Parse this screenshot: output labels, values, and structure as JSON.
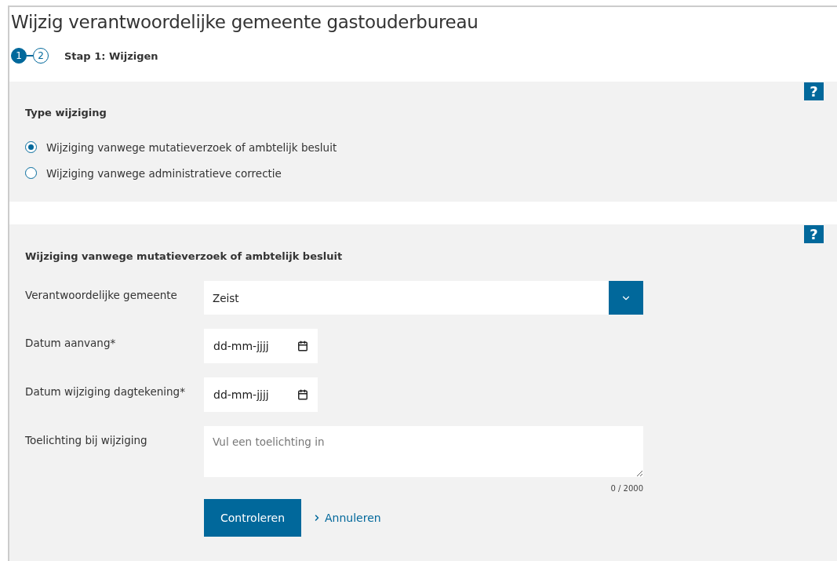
{
  "title": "Wijzig verantwoordelijke gemeente gastouderbureau",
  "steps": [
    {
      "label": "1",
      "selected": true
    },
    {
      "label": "2",
      "selected": false
    }
  ],
  "step_title": "Stap 1: Wijzigen",
  "type_panel": {
    "help": "?",
    "heading": "Type wijziging",
    "options": [
      {
        "label": "Wijziging vanwege mutatieverzoek of ambtelijk besluit",
        "selected": true
      },
      {
        "label": "Wijziging vanwege administratieve correctie",
        "selected": false
      }
    ]
  },
  "form_panel": {
    "help": "?",
    "heading": "Wijziging vanwege mutatieverzoek of ambtelijk besluit",
    "fields": [
      {
        "kind": "select",
        "label": "Verantwoordelijke gemeente",
        "value": "Zeist"
      },
      {
        "kind": "date",
        "label": "Datum aanvang*",
        "placeholder": "dd-mm-jjjj"
      },
      {
        "kind": "date",
        "label": "Datum wijziging dagtekening*",
        "placeholder": "dd-mm-jjjj"
      },
      {
        "kind": "textarea",
        "label": "Toelichting bij wijziging",
        "placeholder": "Vul een toelichting in",
        "counter": "0 / 2000"
      }
    ],
    "submit": "Controleren",
    "cancel": "Annuleren"
  }
}
